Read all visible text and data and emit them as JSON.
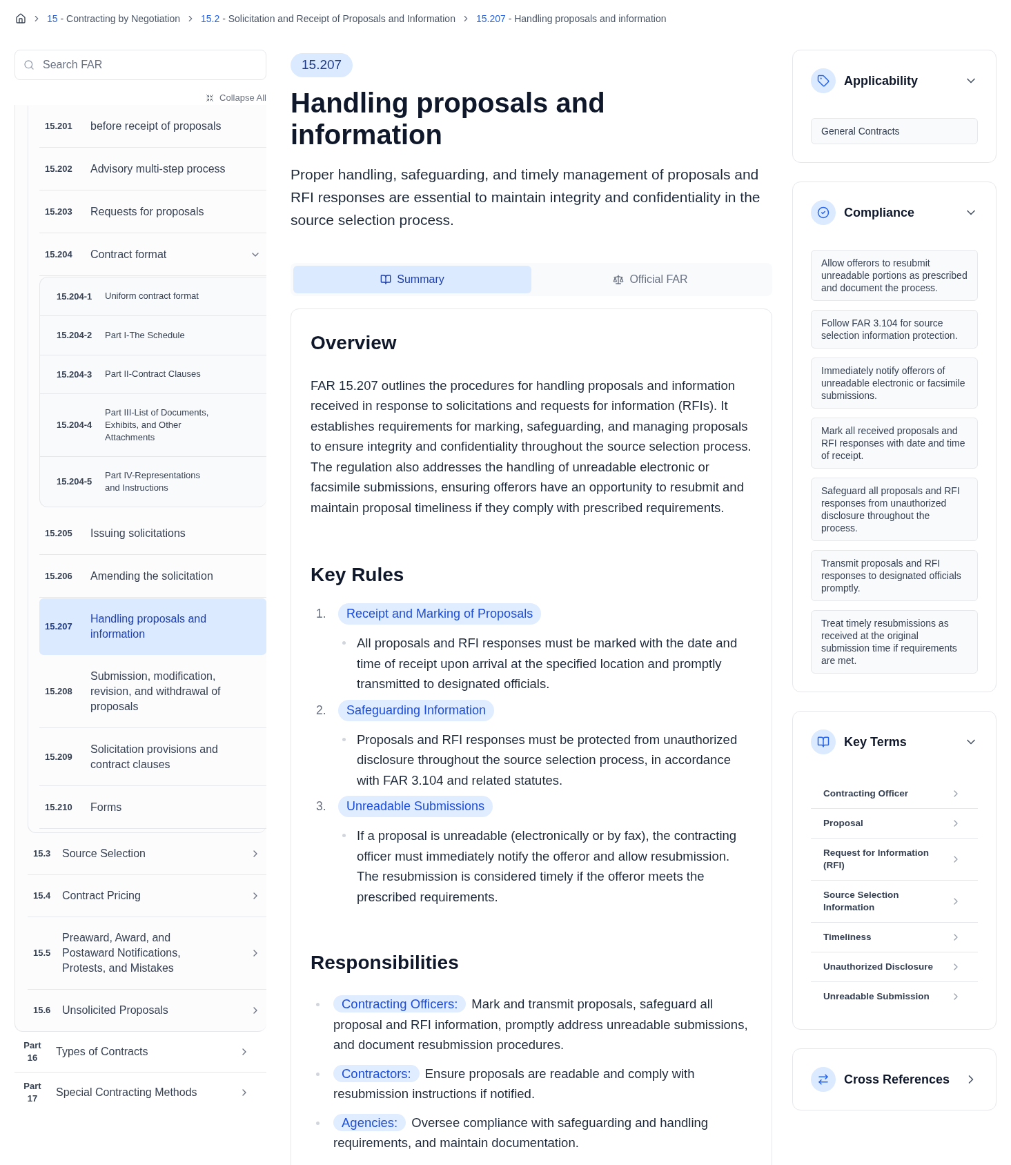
{
  "breadcrumb": [
    {
      "number": "15",
      "separator": "-",
      "title": "Contracting by Negotiation"
    },
    {
      "number": "15.2",
      "separator": "-",
      "title": "Solicitation and Receipt of Proposals and Information"
    },
    {
      "number": "15.207",
      "separator": "-",
      "title": "Handling proposals and information"
    }
  ],
  "sidebar": {
    "search": {
      "placeholder": "Search FAR"
    },
    "collapse_label": "Collapse All",
    "open_part": {
      "open_section": {
        "children": [
          {
            "number": "15.201",
            "title": "before receipt of proposals",
            "selected": false
          },
          {
            "number": "15.202",
            "title": "Advisory multi-step process",
            "selected": false
          },
          {
            "number": "15.203",
            "title": "Requests for proposals",
            "selected": false
          },
          {
            "number": "15.204",
            "title": "Contract format",
            "selected": false,
            "expanded": true,
            "children": [
              {
                "number": "15.204-1",
                "title": "Uniform contract format"
              },
              {
                "number": "15.204-2",
                "title": "Part I-The Schedule"
              },
              {
                "number": "15.204-3",
                "title": "Part II-Contract Clauses"
              },
              {
                "number": "15.204-4",
                "title": "Part III-List of Documents, Exhibits, and Other Attachments"
              },
              {
                "number": "15.204-5",
                "title": "Part IV-Representations and Instructions"
              }
            ]
          },
          {
            "number": "15.205",
            "title": "Issuing solicitations",
            "selected": false
          },
          {
            "number": "15.206",
            "title": "Amending the solicitation",
            "selected": false
          },
          {
            "number": "15.207",
            "title": "Handling proposals and information",
            "selected": true
          },
          {
            "number": "15.208",
            "title": "Submission, modification, revision, and withdrawal of proposals",
            "selected": false
          },
          {
            "number": "15.209",
            "title": "Solicitation provisions and contract clauses",
            "selected": false
          },
          {
            "number": "15.210",
            "title": "Forms",
            "selected": false
          }
        ]
      },
      "children": [
        {
          "number": "15.3",
          "title": "Source Selection",
          "expanded": false
        },
        {
          "number": "15.4",
          "title": "Contract Pricing",
          "expanded": false
        },
        {
          "number": "15.5",
          "title": "Preaward, Award, and Postaward Notifications, Protests, and Mistakes",
          "expanded": false
        },
        {
          "number": "15.6",
          "title": "Unsolicited Proposals",
          "expanded": false
        }
      ]
    },
    "parts": [
      {
        "label": "Part",
        "number": "16",
        "title": "Types of Contracts",
        "expanded": false
      },
      {
        "label": "Part",
        "number": "17",
        "title": "Special Contracting Methods",
        "expanded": false
      }
    ]
  },
  "main": {
    "badge": "15.207",
    "title": "Handling proposals and information",
    "lead": "Proper handling, safeguarding, and timely management of proposals and RFI responses are essential to maintain integrity and confidentiality in the source selection process.",
    "tabs": [
      {
        "label": "Summary",
        "kind": "book",
        "selected": true
      },
      {
        "label": "Official FAR",
        "kind": "scale",
        "selected": false
      }
    ],
    "overview": {
      "heading": "Overview",
      "text": "FAR 15.207 outlines the procedures for handling proposals and information received in response to solicitations and requests for information (RFIs). It establishes requirements for marking, safeguarding, and managing proposals to ensure integrity and confidentiality throughout the source selection process. The regulation also addresses the handling of unreadable electronic or facsimile submissions, ensuring offerors have an opportunity to resubmit and maintain proposal timeliness if they comply with prescribed requirements."
    },
    "key_rules": {
      "heading": "Key Rules",
      "rules": [
        {
          "number": "1.",
          "title": "Receipt and Marking of Proposals",
          "points": [
            "All proposals and RFI responses must be marked with the date and time of receipt upon arrival at the specified location and promptly transmitted to designated officials."
          ]
        },
        {
          "number": "2.",
          "title": "Safeguarding Information",
          "points": [
            "Proposals and RFI responses must be protected from unauthorized disclosure throughout the source selection process, in accordance with FAR 3.104 and related statutes."
          ]
        },
        {
          "number": "3.",
          "title": "Unreadable Submissions",
          "points": [
            "If a proposal is unreadable (electronically or by fax), the contracting officer must immediately notify the offeror and allow resubmission. The resubmission is considered timely if the offeror meets the prescribed requirements."
          ]
        }
      ]
    },
    "responsibilities": {
      "heading": "Responsibilities",
      "items": [
        {
          "role": "Contracting Officers:",
          "text": "Mark and transmit proposals, safeguard all proposal and RFI information, promptly address unreadable submissions, and document resubmission procedures."
        },
        {
          "role": "Contractors:",
          "text": "Ensure proposals are readable and comply with resubmission instructions if notified."
        },
        {
          "role": "Agencies:",
          "text": "Oversee compliance with safeguarding and handling requirements, and maintain documentation."
        }
      ]
    }
  },
  "panels": [
    {
      "title": "Applicability",
      "kind": "applicability",
      "expanded": true,
      "items": [
        "General Contracts"
      ]
    },
    {
      "title": "Compliance",
      "kind": "compliance",
      "expanded": true,
      "items": [
        "Allow offerors to resubmit unreadable portions as prescribed and document the process.",
        "Follow FAR 3.104 for source selection information protection.",
        "Immediately notify offerors of unreadable electronic or facsimile submissions.",
        "Mark all received proposals and RFI responses with date and time of receipt.",
        "Safeguard all proposals and RFI responses from unauthorized disclosure throughout the process.",
        "Transmit proposals and RFI responses to designated officials promptly.",
        "Treat timely resubmissions as received at the original submission time if requirements are met."
      ]
    },
    {
      "title": "Key Terms",
      "kind": "terms",
      "expanded": true,
      "items": [
        "Contracting Officer",
        "Proposal",
        "Request for Information (RFI)",
        "Source Selection Information",
        "Timeliness",
        "Unauthorized Disclosure",
        "Unreadable Submission"
      ]
    },
    {
      "title": "Cross References",
      "kind": "references",
      "expanded": false
    }
  ]
}
